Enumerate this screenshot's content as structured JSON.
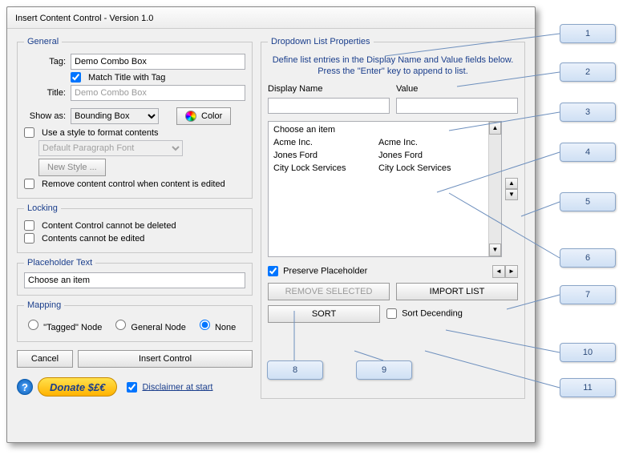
{
  "window": {
    "title": "Insert Content Control - Version 1.0"
  },
  "general": {
    "legend": "General",
    "tag_label": "Tag:",
    "tag_value": "Demo Combo Box",
    "match_title_label": "Match Title with Tag",
    "match_title_checked": true,
    "title_label": "Title:",
    "title_placeholder": "Demo Combo Box",
    "show_as_label": "Show as:",
    "show_as_value": "Bounding Box",
    "color_label": "Color",
    "use_style_label": "Use a style to format contents",
    "use_style_checked": false,
    "style_value": "Default Paragraph Font",
    "new_style_label": "New Style ...",
    "remove_on_edit_label": "Remove content control when content is edited",
    "remove_on_edit_checked": false
  },
  "locking": {
    "legend": "Locking",
    "no_delete_label": "Content Control cannot be deleted",
    "no_delete_checked": false,
    "no_edit_label": "Contents cannot be edited",
    "no_edit_checked": false
  },
  "placeholder": {
    "legend": "Placeholder Text",
    "value": "Choose an item"
  },
  "mapping": {
    "legend": "Mapping",
    "options": {
      "tagged": "\"Tagged\" Node",
      "general": "General Node",
      "none": "None"
    },
    "selected": "none"
  },
  "buttons": {
    "cancel": "Cancel",
    "insert": "Insert Control",
    "donate": "Donate $£€",
    "disclaimer_label": "Disclaimer at start",
    "disclaimer_checked": true
  },
  "dropdown": {
    "legend": "Dropdown List Properties",
    "info": "Define list entries in the Display Name and Value fields below. Press the \"Enter\" key to append to list.",
    "display_name_label": "Display Name",
    "value_label": "Value",
    "display_name_value": "",
    "value_value": "",
    "items": [
      {
        "display": "Choose an item",
        "value": ""
      },
      {
        "display": "Acme Inc.",
        "value": "Acme Inc."
      },
      {
        "display": "Jones Ford",
        "value": "Jones Ford"
      },
      {
        "display": "City Lock Services",
        "value": "City Lock Services"
      }
    ],
    "preserve_label": "Preserve Placeholder",
    "preserve_checked": true,
    "remove_selected": "REMOVE SELECTED",
    "import_list": "IMPORT LIST",
    "sort": "SORT",
    "sort_desc_label": "Sort Decending",
    "sort_desc_checked": false
  },
  "callouts": [
    "1",
    "2",
    "3",
    "4",
    "5",
    "6",
    "7",
    "8",
    "9",
    "10",
    "11"
  ]
}
